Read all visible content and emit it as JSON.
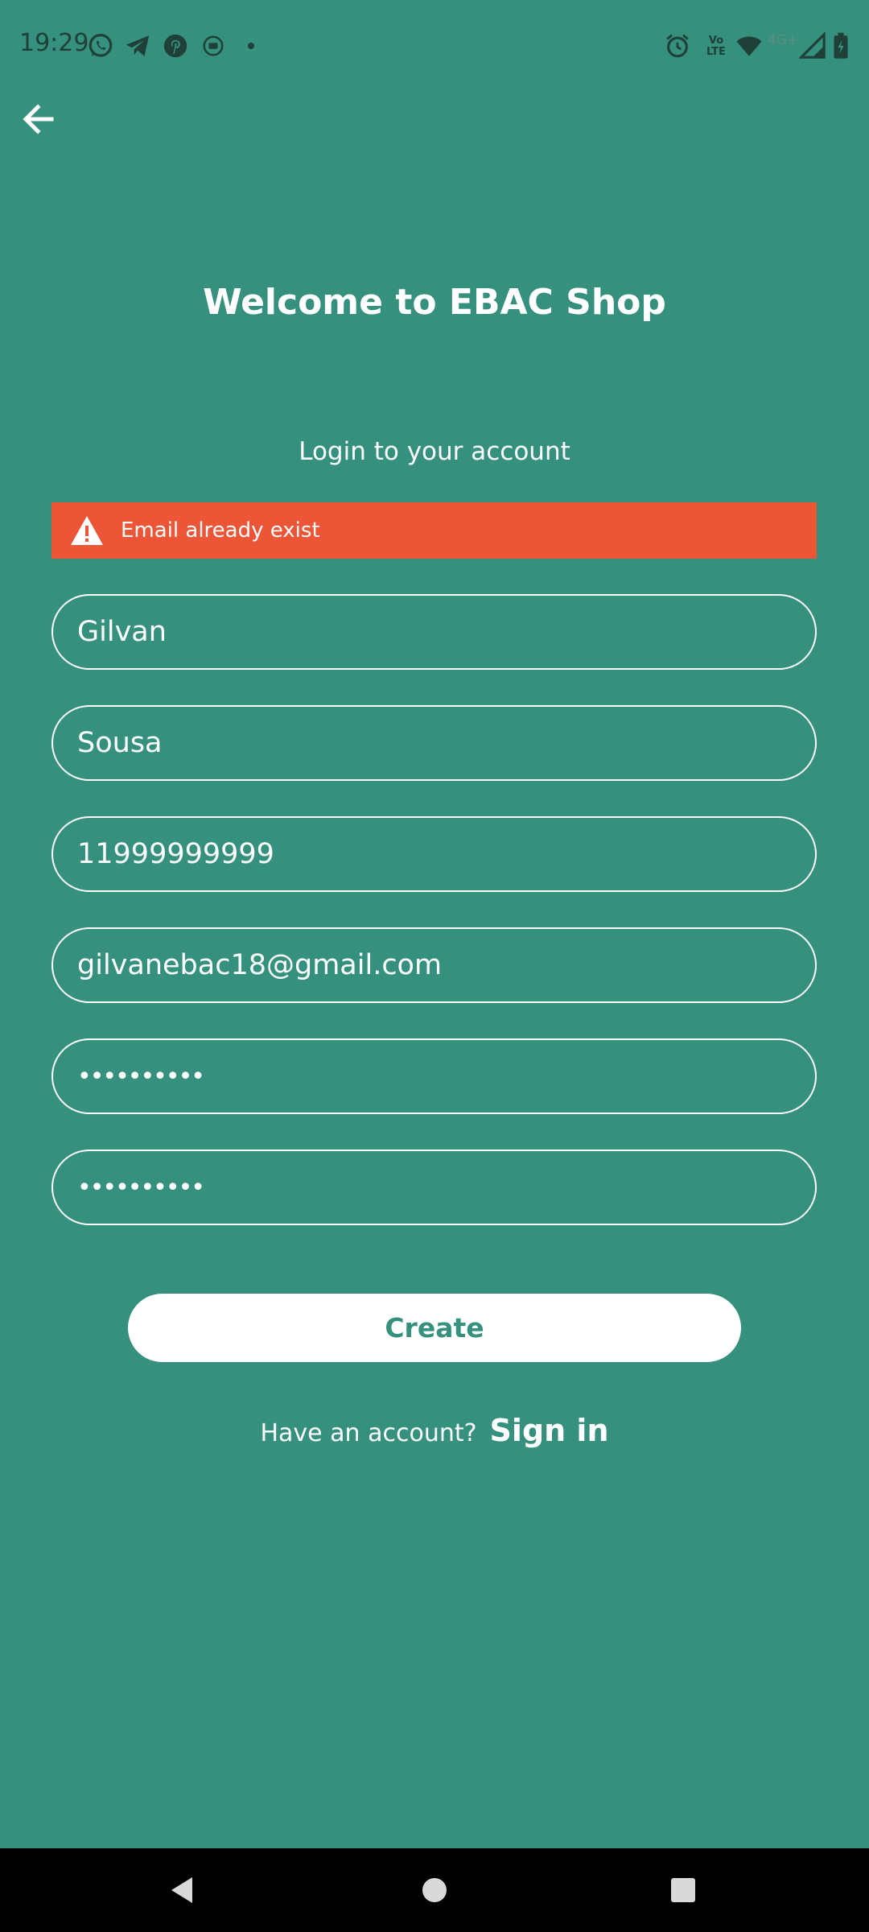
{
  "status_bar": {
    "time": "19:29",
    "volte_label": "Vo LTE",
    "network_label": "4G+",
    "icons": [
      "whatsapp-icon",
      "telegram-icon",
      "pinterest-icon",
      "cast-icon",
      "dot-icon",
      "alarm-icon",
      "volte-icon",
      "wifi-icon",
      "signal-icon",
      "battery-icon"
    ]
  },
  "header": {
    "back_icon": "arrow-left-icon"
  },
  "main": {
    "title": "Welcome to EBAC Shop",
    "subtitle": "Login to your account",
    "error": {
      "icon": "warning-icon",
      "message": "Email already exist",
      "color": "#ec5536"
    },
    "fields": {
      "first_name": "Gilvan",
      "last_name": "Sousa",
      "phone": "11999999999",
      "email": "gilvanebac18@gmail.com",
      "password": "••••••••••",
      "confirm_password": "••••••••••"
    },
    "create_label": "Create",
    "have_account_text": "Have an account?",
    "signin_label": "Sign in"
  },
  "nav_bar": {
    "icons": [
      "back-triangle-icon",
      "home-circle-icon",
      "recents-square-icon"
    ]
  },
  "colors": {
    "background": "#35917d",
    "accent": "#35917d",
    "error": "#ec5536",
    "status_text": "#1f3f38"
  }
}
